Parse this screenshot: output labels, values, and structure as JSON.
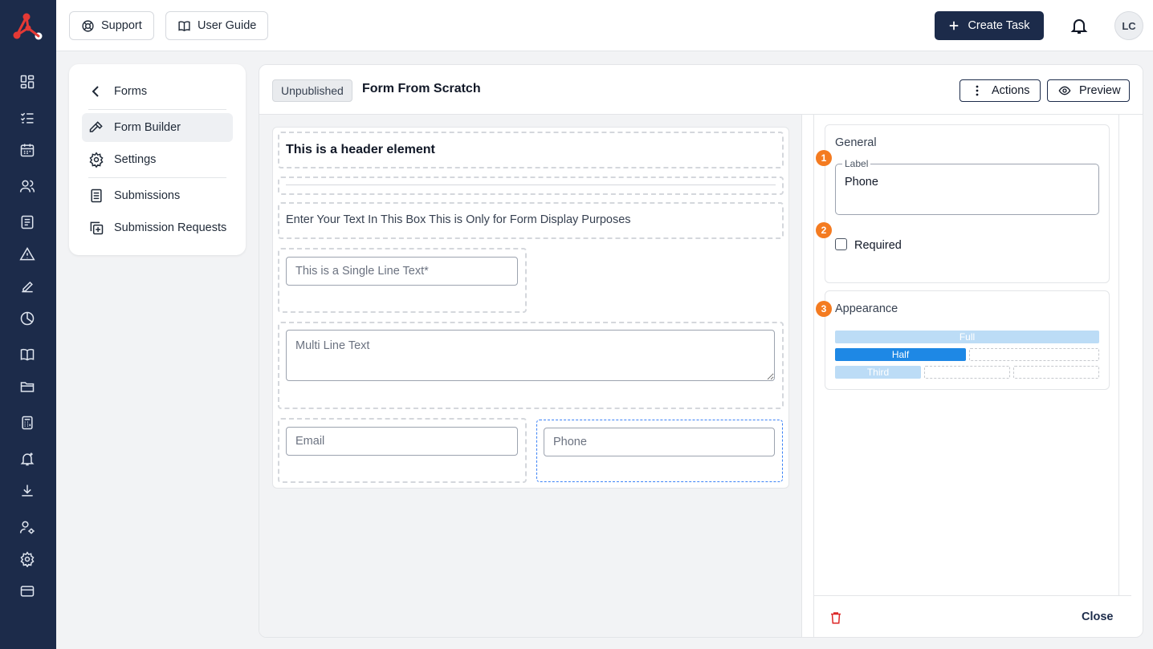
{
  "topbar": {
    "support_label": "Support",
    "user_guide_label": "User Guide",
    "create_task_label": "Create Task",
    "avatar_initials": "LC"
  },
  "sidebar_icons": [
    "dashboard-icon",
    "task-list-icon",
    "calendar-icon",
    "users-icon",
    "forms-icon",
    "alert-icon",
    "signature-icon",
    "reports-icon",
    "book-icon",
    "folder-icon",
    "calculator-icon",
    "notification-add-icon",
    "download-icon",
    "user-settings-icon",
    "settings-icon",
    "billing-icon"
  ],
  "nav": {
    "back_label": "Forms",
    "items": [
      {
        "label": "Form Builder",
        "icon": "hammer-icon",
        "active": true
      },
      {
        "label": "Settings",
        "icon": "gear-icon"
      },
      {
        "label": "Submissions",
        "icon": "document-icon"
      },
      {
        "label": "Submission Requests",
        "icon": "copy-plus-icon"
      }
    ]
  },
  "form": {
    "status": "Unpublished",
    "title": "Form From Scratch",
    "actions_label": "Actions",
    "preview_label": "Preview",
    "elements": {
      "header_text": "This is a header element",
      "paragraph_text": "Enter Your Text In This Box This is Only for Form Display Purposes",
      "single_line_placeholder": "This is a Single Line Text*",
      "multi_line_placeholder": "Multi Line Text",
      "email_placeholder": "Email",
      "phone_placeholder": "Phone"
    }
  },
  "properties": {
    "general_title": "General",
    "label_legend": "Label",
    "label_value": "Phone",
    "required_label": "Required",
    "required_checked": false,
    "appearance_title": "Appearance",
    "widths": {
      "full": "Full",
      "half": "Half",
      "third": "Third",
      "selected": "Half"
    },
    "steps": [
      "1",
      "2",
      "3"
    ],
    "close_label": "Close"
  },
  "colors": {
    "navy": "#1c2b4a",
    "accent_orange": "#f47b20",
    "selected_blue": "#1e88e5",
    "light_blue": "#bcdcf6",
    "danger": "#dc2626"
  }
}
